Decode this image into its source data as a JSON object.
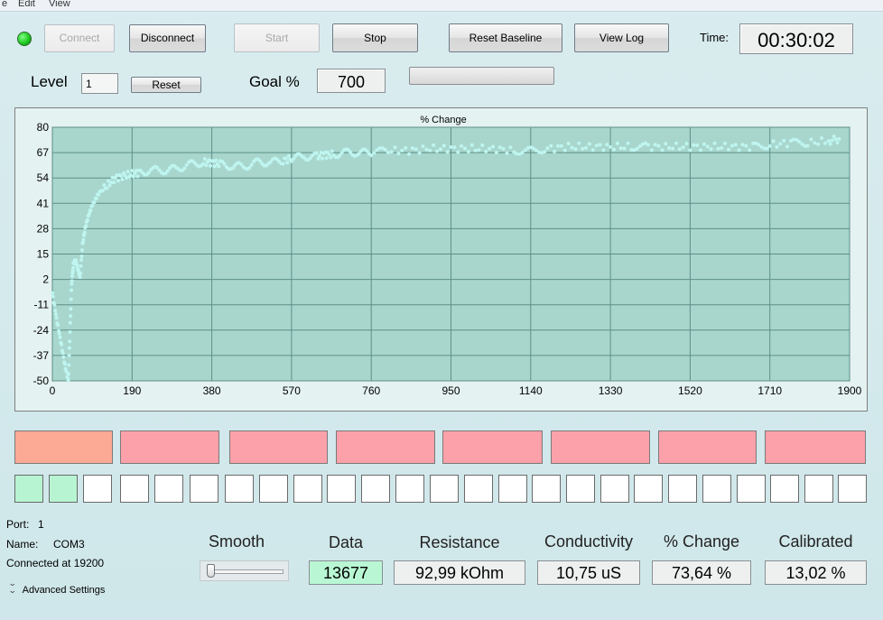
{
  "menu": [
    "e",
    "Edit",
    "View"
  ],
  "status_color": "#19c31c",
  "buttons": {
    "connect": "Connect",
    "disconnect": "Disconnect",
    "start": "Start",
    "stop": "Stop",
    "reset_baseline": "Reset Baseline",
    "view_log": "View Log",
    "reset": "Reset"
  },
  "time": {
    "label": "Time:",
    "value": "00:30:02"
  },
  "level": {
    "label": "Level",
    "value": "1"
  },
  "goal": {
    "label": "Goal %",
    "value": "700"
  },
  "goal_progress": 0,
  "chart_data": {
    "type": "scatter",
    "title": "% Change",
    "xlabel": "",
    "ylabel": "",
    "xlim": [
      0,
      1900
    ],
    "ylim": [
      -50,
      80
    ],
    "xticks": [
      0,
      190,
      380,
      570,
      760,
      950,
      1140,
      1330,
      1520,
      1710,
      1900
    ],
    "yticks": [
      80,
      67,
      54,
      41,
      28,
      15,
      2,
      -11,
      -24,
      -37,
      -50
    ],
    "grid": true,
    "background": "#a8d6cd",
    "marker_color": "#bff5f0",
    "series": [
      {
        "x": [
          0,
          10,
          20,
          30,
          38,
          42,
          46,
          50,
          55,
          60,
          66,
          72,
          78,
          85,
          95,
          110,
          130,
          150,
          170,
          190,
          210,
          240,
          270,
          300,
          330,
          360,
          380,
          400,
          430,
          460,
          490,
          520,
          550,
          570,
          600,
          630,
          650,
          670,
          700,
          730,
          760,
          800,
          850,
          900,
          950,
          1000,
          1050,
          1100,
          1140,
          1180,
          1230,
          1280,
          1330,
          1380,
          1420,
          1470,
          1520,
          1570,
          1620,
          1670,
          1710,
          1760,
          1800,
          1850,
          1875
        ],
        "y": [
          -5,
          -18,
          -30,
          -42,
          -50,
          -25,
          0,
          10,
          12,
          8,
          3,
          20,
          28,
          34,
          40,
          46,
          50,
          54,
          55,
          56,
          57,
          58,
          58,
          59,
          61,
          62,
          62,
          61,
          60,
          60,
          62,
          62,
          63,
          64,
          65,
          65,
          66,
          66,
          67,
          67,
          67,
          68,
          68,
          69,
          69,
          69,
          69,
          68,
          68,
          69,
          70,
          70,
          70,
          70,
          70,
          70,
          70,
          70,
          70,
          70,
          71,
          72,
          72,
          73,
          74
        ]
      }
    ]
  },
  "zones_top": [
    "#fca996",
    "#fca1aa",
    "#fca1aa",
    "#fca1aa",
    "#fca1aa",
    "#fca1aa",
    "#fca1aa",
    "#fca1aa"
  ],
  "squares_green": 2,
  "squares_total": 25,
  "square_green_color": "#b7f5d2",
  "port": {
    "label": "Port:",
    "value": "1"
  },
  "name": {
    "label": "Name:",
    "value": "COM3"
  },
  "connection": "Connected at 19200",
  "advanced": "Advanced Settings",
  "smooth": {
    "label": "Smooth",
    "value": 0
  },
  "readouts": {
    "data": {
      "label": "Data",
      "value": "13677"
    },
    "resistance": {
      "label": "Resistance",
      "value": "92,99 kOhm"
    },
    "conductivity": {
      "label": "Conductivity",
      "value": "10,75 uS"
    },
    "pct_change": {
      "label": "% Change",
      "value": "73,64 %"
    },
    "calibrated": {
      "label": "Calibrated",
      "value": "13,02 %"
    }
  },
  "data_readout_color": "#b9f7d4"
}
